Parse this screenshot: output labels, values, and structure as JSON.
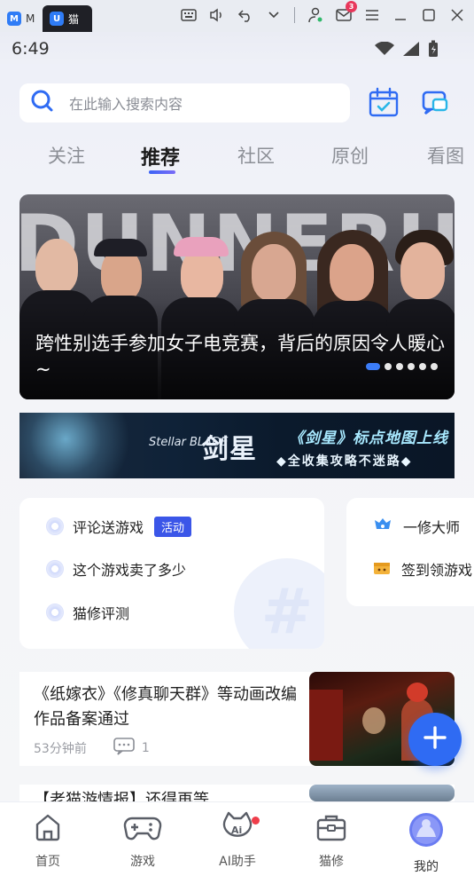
{
  "emulator": {
    "tabs": [
      {
        "label": "M",
        "active": false
      },
      {
        "label": "猫",
        "active": true
      }
    ],
    "notification_count": "3"
  },
  "status_bar": {
    "time": "6:49"
  },
  "search": {
    "placeholder": "在此输入搜索内容"
  },
  "tabs": [
    {
      "label": "关注"
    },
    {
      "label": "推荐",
      "active": true
    },
    {
      "label": "社区"
    },
    {
      "label": "原创"
    },
    {
      "label": "看图"
    }
  ],
  "banner": {
    "title": "跨性别选手参加女子电竞赛，背后的原因令人暖心~",
    "background_text": "DUNNERUDO",
    "dots": 6,
    "active_dot": 0
  },
  "ad": {
    "logo_en": "Stellar BLADE",
    "logo_cn": "剑星",
    "line1": "《剑星》标点地图上线",
    "line2": "◆全收集攻略不迷路◆"
  },
  "topics": {
    "items": [
      {
        "label": "评论送游戏",
        "tag": "活动"
      },
      {
        "label": "这个游戏卖了多少"
      },
      {
        "label": "猫修评测"
      }
    ]
  },
  "side_card": {
    "items": [
      {
        "label": "一修大师"
      },
      {
        "label": "签到领游戏"
      }
    ]
  },
  "news": [
    {
      "title": "《纸嫁衣》《修真聊天群》等动画改编作品备案通过",
      "time": "53分钟前",
      "comments": "1"
    },
    {
      "title": "【老猫游情报】还得再等..."
    }
  ],
  "bottom_nav": [
    {
      "label": "首页",
      "icon": "home-icon"
    },
    {
      "label": "游戏",
      "icon": "gamepad-icon"
    },
    {
      "label": "AI助手",
      "icon": "ai-cat-icon",
      "badge": true
    },
    {
      "label": "猫修",
      "icon": "toolbox-icon"
    },
    {
      "label": "我的",
      "icon": "avatar-icon",
      "active": true
    }
  ],
  "colors": {
    "accent": "#2f6bf3",
    "tag_bg": "#3b56e8",
    "badge_red": "#ef3d4a"
  }
}
